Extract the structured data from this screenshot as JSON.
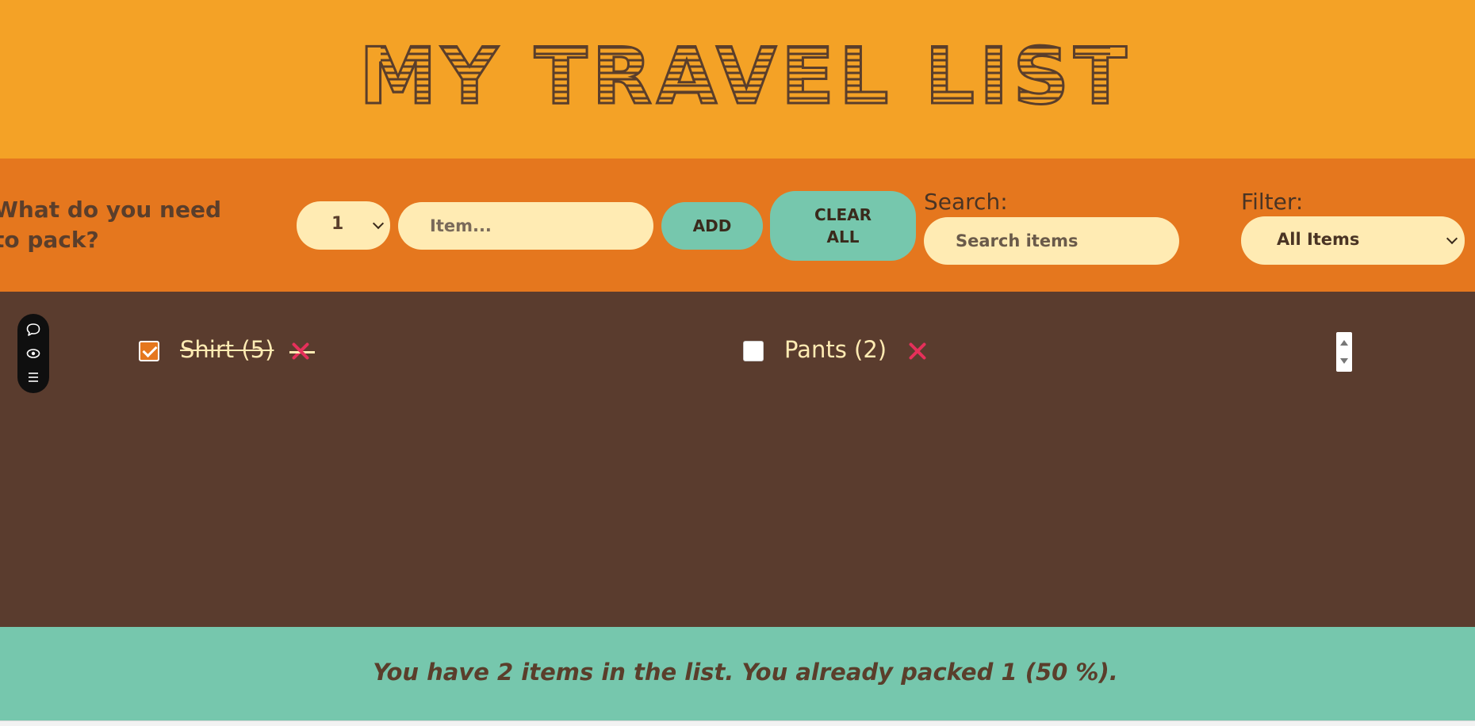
{
  "header": {
    "title": "MY TRAVEL LIST"
  },
  "form": {
    "prompt": "What do you need to pack?",
    "quantity": {
      "selected": "1"
    },
    "item_input": {
      "placeholder": "Item..."
    },
    "add_label": "ADD",
    "clear_label": "CLEAR ALL",
    "search": {
      "label": "Search:",
      "placeholder": "Search items"
    },
    "filter": {
      "label": "Filter:",
      "selected": "All Items"
    }
  },
  "list": {
    "items": [
      {
        "label": "Shirt (5)",
        "packed": true
      },
      {
        "label": "Pants (2)",
        "packed": false
      }
    ]
  },
  "stats": {
    "text": "You have 2 items in the list. You already packed 1 (50 %)."
  },
  "toolbar": {
    "icons": [
      "chat-bubble-icon",
      "eye-icon",
      "menu-icon"
    ]
  },
  "colors": {
    "header_bg": "#f4a226",
    "form_bg": "#e5771e",
    "list_bg": "#5a3c2e",
    "stats_bg": "#76c7ad",
    "accent_text": "#ffebb3",
    "delete_color": "#e5305a",
    "dark_text": "#5a3e2b"
  }
}
